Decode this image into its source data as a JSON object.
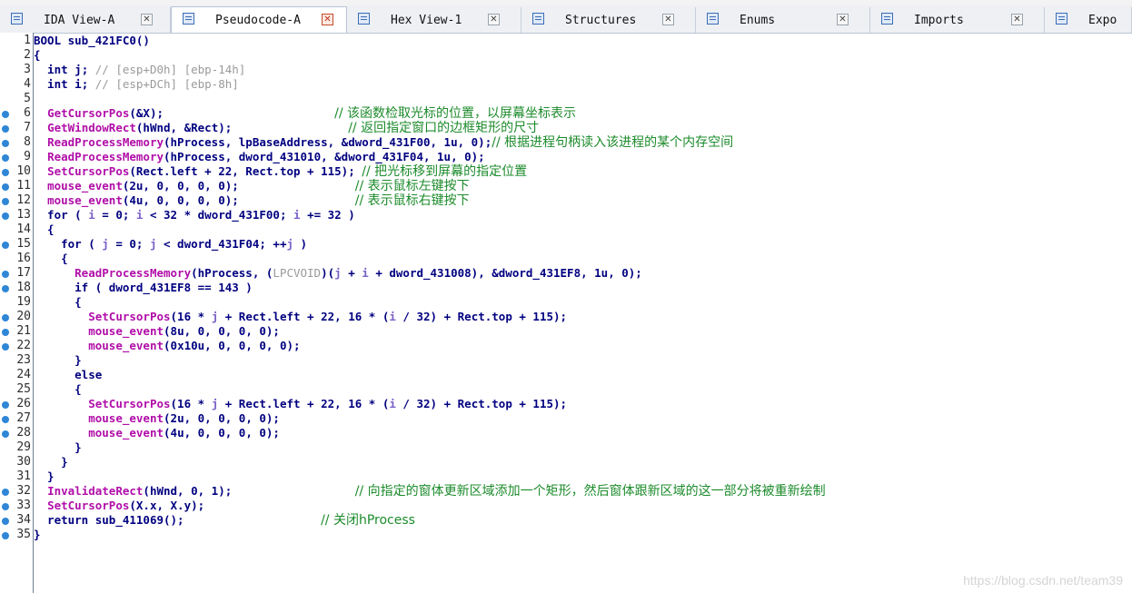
{
  "tabs": [
    {
      "label": "IDA View-A",
      "active": false,
      "icon": "ida-view-icon"
    },
    {
      "label": "Pseudocode-A",
      "active": true,
      "icon": "pseudocode-icon"
    },
    {
      "label": "Hex View-1",
      "active": false,
      "icon": "hex-view-icon"
    },
    {
      "label": "Structures",
      "active": false,
      "icon": "structures-icon"
    },
    {
      "label": "Enums",
      "active": false,
      "icon": "enums-icon"
    },
    {
      "label": "Imports",
      "active": false,
      "icon": "imports-icon"
    },
    {
      "label": "Expo",
      "active": false,
      "icon": "exports-icon"
    }
  ],
  "tab_close_glyph": "✕",
  "code_lines": [
    {
      "n": "1",
      "dot": false,
      "segs": [
        [
          "kw-hl",
          "BOOL"
        ],
        [
          "plain",
          " sub_421FC0()"
        ]
      ]
    },
    {
      "n": "2",
      "dot": false,
      "segs": [
        [
          "plain",
          "{"
        ]
      ]
    },
    {
      "n": "3",
      "dot": false,
      "segs": [
        [
          "kw",
          "  int"
        ],
        [
          "plain",
          " j; "
        ],
        [
          "gray",
          "// [esp+D0h] [ebp-14h]"
        ]
      ]
    },
    {
      "n": "4",
      "dot": false,
      "segs": [
        [
          "kw",
          "  int"
        ],
        [
          "plain",
          " i; "
        ],
        [
          "gray",
          "// [esp+DCh] [ebp-8h]"
        ]
      ]
    },
    {
      "n": "5",
      "dot": false,
      "segs": [
        [
          "plain",
          ""
        ]
      ]
    },
    {
      "n": "6",
      "dot": true,
      "segs": [
        [
          "plain",
          "  "
        ],
        [
          "fn",
          "GetCursorPos"
        ],
        [
          "plain",
          "(&X);                         "
        ],
        [
          "cmt",
          "// 该函数检取光标的位置，以屏幕坐标表示"
        ]
      ]
    },
    {
      "n": "7",
      "dot": true,
      "segs": [
        [
          "plain",
          "  "
        ],
        [
          "fn",
          "GetWindowRect"
        ],
        [
          "plain",
          "(hWnd, &Rect);                 "
        ],
        [
          "cmt",
          "// 返回指定窗口的边框矩形的尺寸"
        ]
      ]
    },
    {
      "n": "8",
      "dot": true,
      "segs": [
        [
          "plain",
          "  "
        ],
        [
          "fn",
          "ReadProcessMemory"
        ],
        [
          "plain",
          "(hProcess, lpBaseAddress, &dword_431F00, 1u, 0);"
        ],
        [
          "cmt",
          "// 根据进程句柄读入该进程的某个内存空间"
        ]
      ]
    },
    {
      "n": "9",
      "dot": true,
      "segs": [
        [
          "plain",
          "  "
        ],
        [
          "fn",
          "ReadProcessMemory"
        ],
        [
          "plain",
          "(hProcess, dword_431010, &dword_431F04, 1u, 0);"
        ]
      ]
    },
    {
      "n": "10",
      "dot": true,
      "segs": [
        [
          "plain",
          "  "
        ],
        [
          "fn",
          "SetCursorPos"
        ],
        [
          "plain",
          "(Rect.left + 22, Rect.top + 115); "
        ],
        [
          "cmt",
          "// 把光标移到屏幕的指定位置"
        ]
      ]
    },
    {
      "n": "11",
      "dot": true,
      "segs": [
        [
          "plain",
          "  "
        ],
        [
          "fn",
          "mouse_event"
        ],
        [
          "plain",
          "(2u, 0, 0, 0, 0);                 "
        ],
        [
          "cmt",
          "// 表示鼠标左键按下"
        ]
      ]
    },
    {
      "n": "12",
      "dot": true,
      "segs": [
        [
          "plain",
          "  "
        ],
        [
          "fn",
          "mouse_event"
        ],
        [
          "plain",
          "(4u, 0, 0, 0, 0);                 "
        ],
        [
          "cmt",
          "// 表示鼠标右键按下"
        ]
      ]
    },
    {
      "n": "13",
      "dot": true,
      "segs": [
        [
          "kw",
          "  for"
        ],
        [
          "plain",
          " ( "
        ],
        [
          "var",
          "i"
        ],
        [
          "plain",
          " = 0; "
        ],
        [
          "var",
          "i"
        ],
        [
          "plain",
          " < 32 * dword_431F00; "
        ],
        [
          "var",
          "i"
        ],
        [
          "plain",
          " += 32 )"
        ]
      ]
    },
    {
      "n": "14",
      "dot": false,
      "segs": [
        [
          "plain",
          "  {"
        ]
      ]
    },
    {
      "n": "15",
      "dot": true,
      "segs": [
        [
          "kw",
          "    for"
        ],
        [
          "plain",
          " ( "
        ],
        [
          "var",
          "j"
        ],
        [
          "plain",
          " = 0; "
        ],
        [
          "var",
          "j"
        ],
        [
          "plain",
          " < dword_431F04; ++"
        ],
        [
          "var",
          "j"
        ],
        [
          "plain",
          " )"
        ]
      ]
    },
    {
      "n": "16",
      "dot": false,
      "segs": [
        [
          "plain",
          "    {"
        ]
      ]
    },
    {
      "n": "17",
      "dot": true,
      "segs": [
        [
          "plain",
          "      "
        ],
        [
          "fn",
          "ReadProcessMemory"
        ],
        [
          "plain",
          "(hProcess, ("
        ],
        [
          "gray",
          "LPCVOID"
        ],
        [
          "plain",
          ")("
        ],
        [
          "var",
          "j"
        ],
        [
          "plain",
          " + "
        ],
        [
          "var",
          "i"
        ],
        [
          "plain",
          " + dword_431008), &dword_431EF8, 1u, 0);"
        ]
      ]
    },
    {
      "n": "18",
      "dot": true,
      "segs": [
        [
          "kw",
          "      if"
        ],
        [
          "plain",
          " ( dword_431EF8 == 143 )"
        ]
      ]
    },
    {
      "n": "19",
      "dot": false,
      "segs": [
        [
          "plain",
          "      {"
        ]
      ]
    },
    {
      "n": "20",
      "dot": true,
      "segs": [
        [
          "plain",
          "        "
        ],
        [
          "fn",
          "SetCursorPos"
        ],
        [
          "plain",
          "(16 * "
        ],
        [
          "var",
          "j"
        ],
        [
          "plain",
          " + Rect.left + 22, 16 * ("
        ],
        [
          "var",
          "i"
        ],
        [
          "plain",
          " / 32) + Rect.top + 115);"
        ]
      ]
    },
    {
      "n": "21",
      "dot": true,
      "segs": [
        [
          "plain",
          "        "
        ],
        [
          "fn",
          "mouse_event"
        ],
        [
          "plain",
          "(8u, 0, 0, 0, 0);"
        ]
      ]
    },
    {
      "n": "22",
      "dot": true,
      "segs": [
        [
          "plain",
          "        "
        ],
        [
          "fn",
          "mouse_event"
        ],
        [
          "plain",
          "(0x10u, 0, 0, 0, 0);"
        ]
      ]
    },
    {
      "n": "23",
      "dot": false,
      "segs": [
        [
          "plain",
          "      }"
        ]
      ]
    },
    {
      "n": "24",
      "dot": false,
      "segs": [
        [
          "kw",
          "      else"
        ]
      ]
    },
    {
      "n": "25",
      "dot": false,
      "segs": [
        [
          "plain",
          "      {"
        ]
      ]
    },
    {
      "n": "26",
      "dot": true,
      "segs": [
        [
          "plain",
          "        "
        ],
        [
          "fn",
          "SetCursorPos"
        ],
        [
          "plain",
          "(16 * "
        ],
        [
          "var",
          "j"
        ],
        [
          "plain",
          " + Rect.left + 22, 16 * ("
        ],
        [
          "var",
          "i"
        ],
        [
          "plain",
          " / 32) + Rect.top + 115);"
        ]
      ]
    },
    {
      "n": "27",
      "dot": true,
      "segs": [
        [
          "plain",
          "        "
        ],
        [
          "fn",
          "mouse_event"
        ],
        [
          "plain",
          "(2u, 0, 0, 0, 0);"
        ]
      ]
    },
    {
      "n": "28",
      "dot": true,
      "segs": [
        [
          "plain",
          "        "
        ],
        [
          "fn",
          "mouse_event"
        ],
        [
          "plain",
          "(4u, 0, 0, 0, 0);"
        ]
      ]
    },
    {
      "n": "29",
      "dot": false,
      "segs": [
        [
          "plain",
          "      }"
        ]
      ]
    },
    {
      "n": "30",
      "dot": false,
      "segs": [
        [
          "plain",
          "    }"
        ]
      ]
    },
    {
      "n": "31",
      "dot": false,
      "segs": [
        [
          "plain",
          "  }"
        ]
      ]
    },
    {
      "n": "32",
      "dot": true,
      "segs": [
        [
          "plain",
          "  "
        ],
        [
          "fn",
          "InvalidateRect"
        ],
        [
          "plain",
          "(hWnd, 0, 1);                  "
        ],
        [
          "cmt",
          "// 向指定的窗体更新区域添加一个矩形，然后窗体跟新区域的这一部分将被重新绘制"
        ]
      ]
    },
    {
      "n": "33",
      "dot": true,
      "segs": [
        [
          "plain",
          "  "
        ],
        [
          "fn",
          "SetCursorPos"
        ],
        [
          "plain",
          "(X.x, X.y);"
        ]
      ]
    },
    {
      "n": "34",
      "dot": true,
      "segs": [
        [
          "kw",
          "  return"
        ],
        [
          "plain",
          " sub_411069();                    "
        ],
        [
          "cmt",
          "// 关闭hProcess"
        ]
      ]
    },
    {
      "n": "35",
      "dot": true,
      "segs": [
        [
          "plain",
          "}"
        ]
      ]
    }
  ],
  "watermark": "https://blog.csdn.net/team39",
  "colors": {
    "function": "#b00ea8",
    "keyword": "#00007f",
    "comment": "#1c8b2b",
    "local_var": "#7b62c9",
    "highlight": "#ffff44",
    "breakpoint_dot": "#2f86d6"
  }
}
